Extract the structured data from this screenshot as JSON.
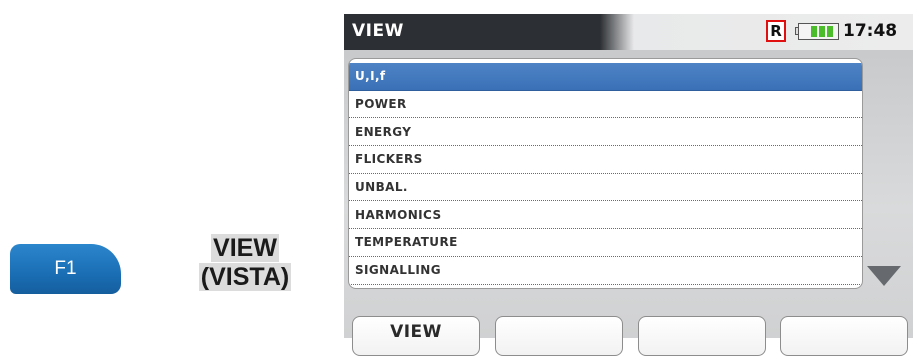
{
  "legend": {
    "key_label": "F1",
    "function_line1": "VIEW",
    "function_line2": "(VISTA)"
  },
  "screen": {
    "title": "VIEW",
    "record_indicator": "R",
    "time": "17:48",
    "battery_icon": "battery-icon",
    "list_items": [
      "U,I,f",
      "POWER",
      "ENERGY",
      "FLICKERS",
      "UNBAL.",
      "HARMONICS",
      "TEMPERATURE",
      "SIGNALLING"
    ],
    "selected_index": 0,
    "scroll_icon": "triangle-down-icon",
    "function_buttons": [
      "VIEW",
      "",
      "",
      ""
    ]
  },
  "colors": {
    "selected_row": "#3a70b6",
    "record_border": "#e01010",
    "battery_level": "#4cbd2a",
    "f1_key": "#1a6eb4"
  }
}
